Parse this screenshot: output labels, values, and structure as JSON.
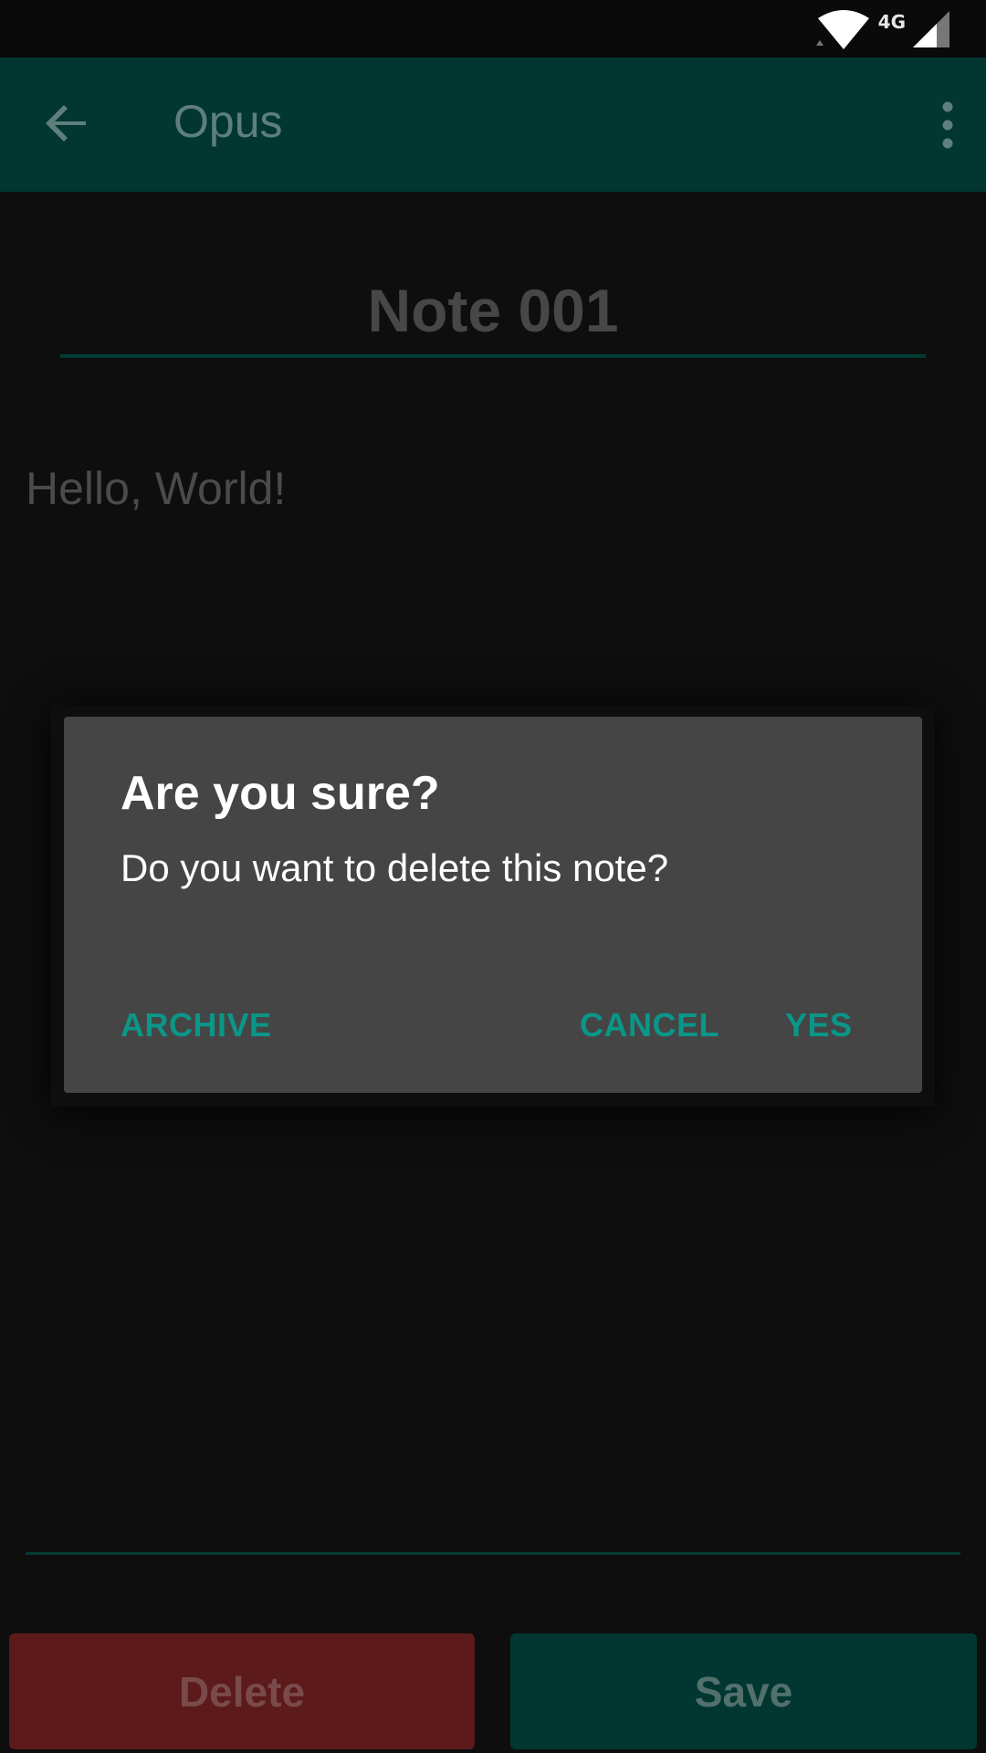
{
  "status_bar": {
    "network_type": "4G",
    "icons": [
      "wifi-icon",
      "cell-signal-icon"
    ]
  },
  "app_bar": {
    "title": "Opus",
    "back_icon": "arrow-back-icon",
    "menu_icon": "more-vert-icon",
    "color": "#023731"
  },
  "note": {
    "title": "Note 001",
    "body": "Hello, World!"
  },
  "dialog": {
    "title": "Are you sure?",
    "message": "Do you want to delete this note?",
    "archive_label": "ARCHIVE",
    "cancel_label": "CANCEL",
    "yes_label": "YES",
    "accent_color": "#0a9688"
  },
  "actions": {
    "delete_label": "Delete",
    "save_label": "Save",
    "delete_color": "#5c1a1a",
    "save_color": "#023731"
  }
}
